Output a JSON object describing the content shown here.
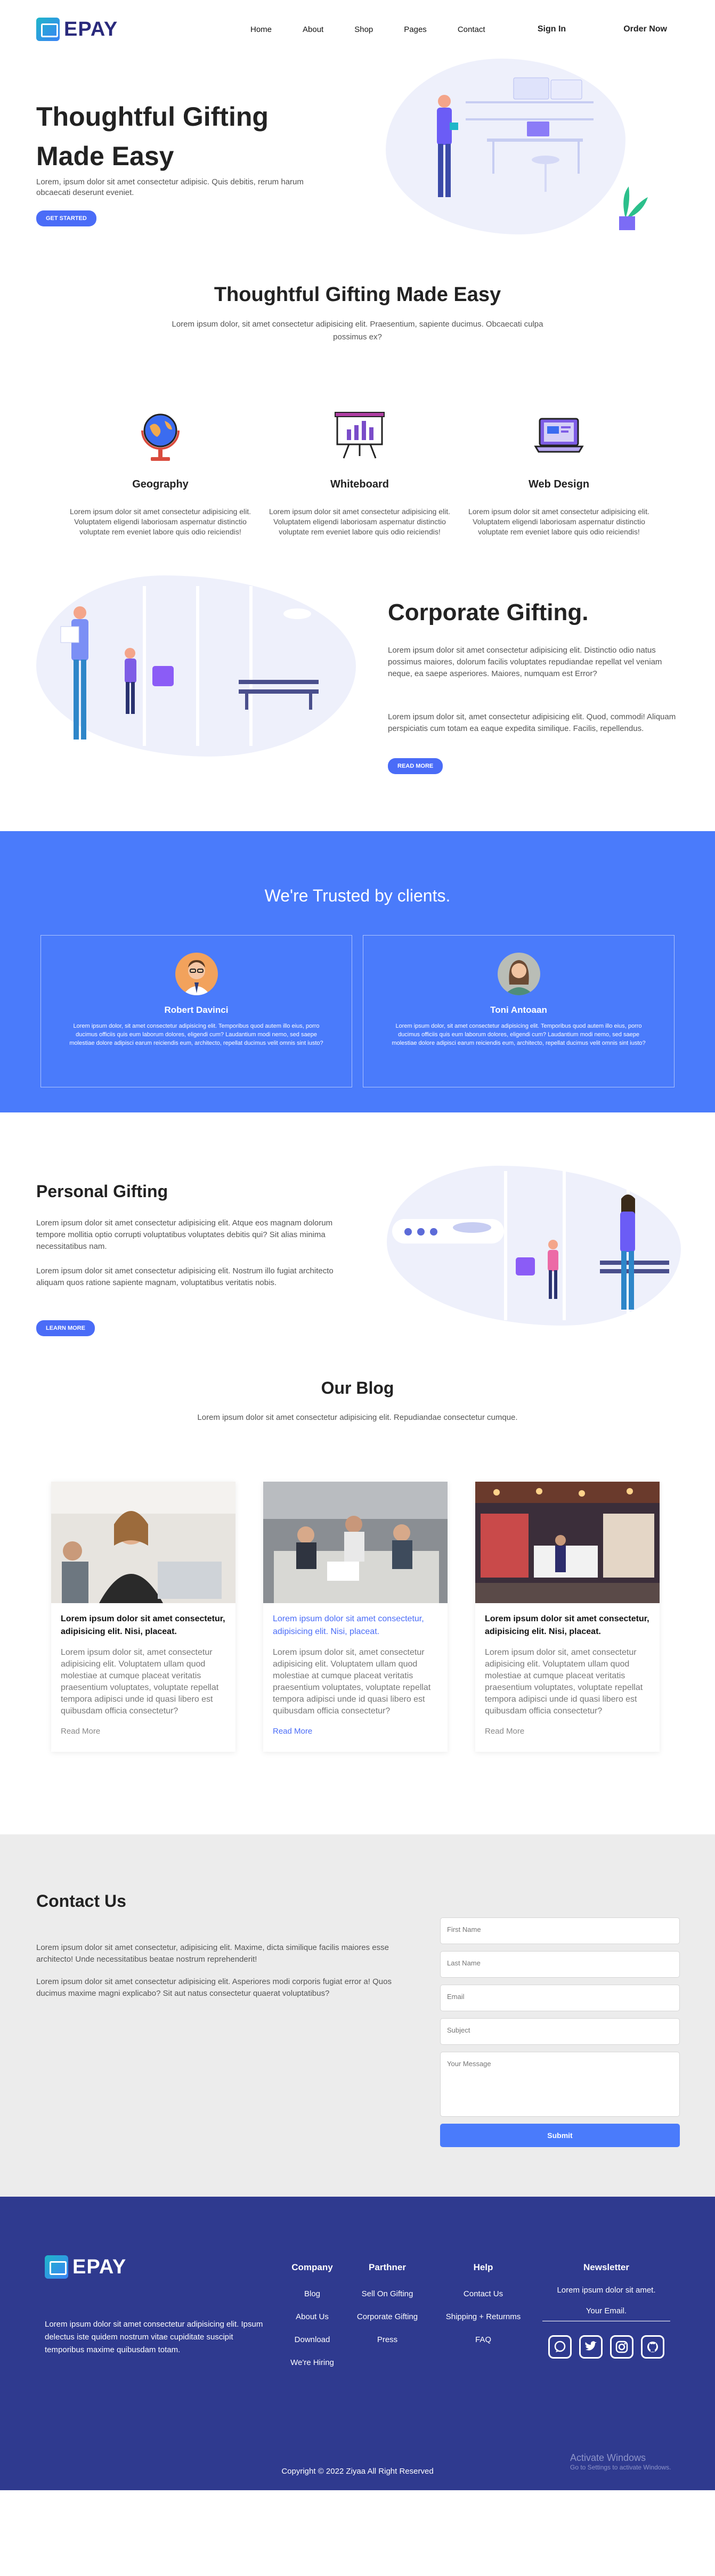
{
  "nav": {
    "logo": "EPAY",
    "links": [
      "Home",
      "About",
      "Shop",
      "Pages",
      "Contact"
    ],
    "signin": "Sign In",
    "order": "Order Now"
  },
  "hero": {
    "title": "Thoughtful Gifting Made Easy",
    "text": "Lorem, ipsum dolor sit amet consectetur adipisic. Quis debitis, rerum harum obcaecati deserunt eveniet.",
    "button": "GET STARTED"
  },
  "intro": {
    "title": "Thoughtful Gifting Made Easy",
    "text": "Lorem ipsum dolor, sit amet consectetur adipisicing elit. Praesentium, sapiente ducimus. Obcaecati culpa possimus ex?",
    "features": [
      {
        "title": "Geography",
        "text": "Lorem ipsum dolor sit amet consectetur adipisicing elit. Voluptatem eligendi laboriosam aspernatur distinctio voluptate rem eveniet labore quis odio reiciendis!"
      },
      {
        "title": "Whiteboard",
        "text": "Lorem ipsum dolor sit amet consectetur adipisicing elit. Voluptatem eligendi laboriosam aspernatur distinctio voluptate rem eveniet labore quis odio reiciendis!"
      },
      {
        "title": "Web Design",
        "text": "Lorem ipsum dolor sit amet consectetur adipisicing elit. Voluptatem eligendi laboriosam aspernatur distinctio voluptate rem eveniet labore quis odio reiciendis!"
      }
    ]
  },
  "corporate": {
    "title": "Corporate Gifting.",
    "p1": "Lorem ipsum dolor sit amet consectetur adipisicing elit. Distinctio odio natus possimus maiores, dolorum facilis voluptates repudiandae repellat vel veniam neque, ea saepe asperiores. Maiores, numquam est Error?",
    "p2": "Lorem ipsum dolor sit, amet consectetur adipisicing elit. Quod, commodi! Aliquam perspiciatis cum totam ea eaque expedita similique. Facilis, repellendus.",
    "button": "READ MORE"
  },
  "trusted": {
    "title": "We're Trusted by clients.",
    "clients": [
      {
        "name": "Robert Davinci",
        "text": "Lorem ipsum dolor, sit amet consectetur adipisicing elit. Temporibus quod autem illo eius, porro ducimus officiis quis eum laborum dolores, eligendi cum? Laudantium modi nemo, sed saepe molestiae dolore adipisci earum reiciendis eum, architecto, repellat ducimus velit omnis sint iusto?"
      },
      {
        "name": "Toni Antoaan",
        "text": "Lorem ipsum dolor, sit amet consectetur adipisicing elit. Temporibus quod autem illo eius, porro ducimus officiis quis eum laborum dolores, eligendi cum? Laudantium modi nemo, sed saepe molestiae dolore adipisci earum reiciendis eum, architecto, repellat ducimus velit omnis sint iusto?"
      }
    ]
  },
  "personal": {
    "title": "Personal Gifting",
    "p1": "Lorem ipsum dolor sit amet consectetur adipisicing elit. Atque eos magnam dolorum tempore mollitia optio corrupti voluptatibus voluptates debitis qui? Sit alias minima necessitatibus nam.",
    "p2": "Lorem ipsum dolor sit amet consectetur adipisicing elit. Nostrum illo fugiat architecto aliquam quos ratione sapiente magnam, voluptatibus veritatis nobis.",
    "button": "LEARN MORE"
  },
  "blog": {
    "title": "Our Blog",
    "text": "Lorem ipsum dolor sit amet consectetur adipisicing elit. Repudiandae consectetur cumque.",
    "posts": [
      {
        "title": "Lorem ipsum dolor sit amet consectetur, adipisicing elit. Nisi, placeat.",
        "text": "Lorem ipsum dolor sit, amet consectetur adipisicing elit. Voluptatem ullam quod molestiae at cumque placeat veritatis praesentium voluptates, voluptate repellat tempora adipisci unde id quasi libero est quibusdam officia consectetur?",
        "link": "Read More"
      },
      {
        "title": "Lorem ipsum dolor sit amet consectetur, adipisicing elit. Nisi, placeat.",
        "text": "Lorem ipsum dolor sit, amet consectetur adipisicing elit. Voluptatem ullam quod molestiae at cumque placeat veritatis praesentium voluptates, voluptate repellat tempora adipisci unde id quasi libero est quibusdam officia consectetur?",
        "link": "Read More"
      },
      {
        "title": "Lorem ipsum dolor sit amet consectetur, adipisicing elit. Nisi, placeat.",
        "text": "Lorem ipsum dolor sit, amet consectetur adipisicing elit. Voluptatem ullam quod molestiae at cumque placeat veritatis praesentium voluptates, voluptate repellat tempora adipisci unde id quasi libero est quibusdam officia consectetur?",
        "link": "Read More"
      }
    ]
  },
  "contact": {
    "title": "Contact Us",
    "p1": "Lorem ipsum dolor sit amet consectetur, adipisicing elit. Maxime, dicta similique facilis maiores esse architecto! Unde necessitatibus beatae nostrum reprehenderit!",
    "p2": "Lorem ipsum dolor sit amet consectetur adipisicing elit. Asperiores modi corporis fugiat error a! Quos ducimus maxime magni explicabo? Sit aut natus consectetur quaerat voluptatibus?",
    "fields": {
      "first": "First Name",
      "last": "Last Name",
      "email": "Email",
      "subject": "Subject",
      "message": "Your Message"
    },
    "submit": "Submit"
  },
  "footer": {
    "logo": "EPAY",
    "text": "Lorem ipsum dolor sit amet consectetur adipisicing elit. Ipsum delectus iste quidem nostrum vitae cupiditate suscipit temporibus maxime quibusdam totam.",
    "company": {
      "title": "Company",
      "links": [
        "Blog",
        "About Us",
        "Download",
        "We're Hiring"
      ]
    },
    "partner": {
      "title": "Parthner",
      "links": [
        "Sell On Gifting",
        "Corporate Gifting",
        "Press"
      ]
    },
    "help": {
      "title": "Help",
      "links": [
        "Contact Us",
        "Shipping + Returnms",
        "FAQ"
      ]
    },
    "newsletter": {
      "title": "Newsletter",
      "text": "Lorem ipsum dolor sit amet.",
      "email": "Your Email."
    },
    "copyright": "Copyright © 2022 Ziyaa All Right Reserved",
    "watermark_title": "Activate Windows",
    "watermark_sub": "Go to Settings to activate Windows."
  },
  "colors": {
    "accent": "#4a7bfb",
    "navy": "#2f3a8f",
    "title": "#2a2a7c"
  }
}
